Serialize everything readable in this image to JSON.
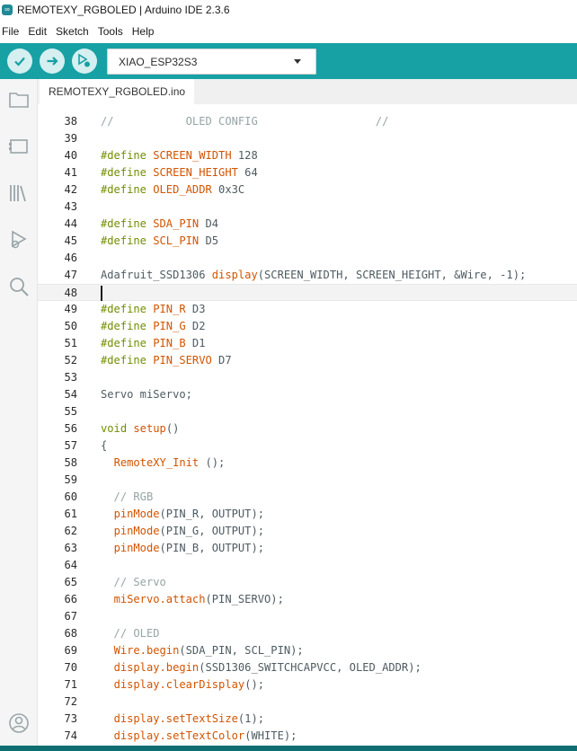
{
  "window": {
    "title": "REMOTEXY_RGBOLED | Arduino IDE 2.3.6",
    "app_icon": "arduino-icon"
  },
  "menu": [
    "File",
    "Edit",
    "Sketch",
    "Tools",
    "Help"
  ],
  "toolbar": {
    "verify": "check-icon",
    "upload": "arrow-right-icon",
    "debug": "debug-icon",
    "board": "XIAO_ESP32S3",
    "accent": "#17a1a5"
  },
  "sidebar": [
    "folder-icon",
    "board-icon",
    "library-icon",
    "debug-icon",
    "search-icon",
    "account-icon"
  ],
  "tab": {
    "label": "REMOTEXY_RGBOLED.ino"
  },
  "editor": {
    "current_line": 48,
    "lines": [
      {
        "n": "38",
        "text": "//           OLED CONFIG                  //"
      },
      {
        "n": "39",
        "text": ""
      },
      {
        "n": "40",
        "text": "#define SCREEN_WIDTH 128"
      },
      {
        "n": "41",
        "text": "#define SCREEN_HEIGHT 64"
      },
      {
        "n": "42",
        "text": "#define OLED_ADDR 0x3C"
      },
      {
        "n": "43",
        "text": ""
      },
      {
        "n": "44",
        "text": "#define SDA_PIN D4"
      },
      {
        "n": "45",
        "text": "#define SCL_PIN D5"
      },
      {
        "n": "46",
        "text": ""
      },
      {
        "n": "47",
        "text": "Adafruit_SSD1306 display(SCREEN_WIDTH, SCREEN_HEIGHT, &Wire, -1);"
      },
      {
        "n": "48",
        "text": ""
      },
      {
        "n": "49",
        "text": "#define PIN_R D3"
      },
      {
        "n": "50",
        "text": "#define PIN_G D2"
      },
      {
        "n": "51",
        "text": "#define PIN_B D1"
      },
      {
        "n": "52",
        "text": "#define PIN_SERVO D7"
      },
      {
        "n": "53",
        "text": ""
      },
      {
        "n": "54",
        "text": "Servo miServo;"
      },
      {
        "n": "55",
        "text": ""
      },
      {
        "n": "56",
        "text": "void setup()"
      },
      {
        "n": "57",
        "text": "{"
      },
      {
        "n": "58",
        "text": "  RemoteXY_Init ();"
      },
      {
        "n": "59",
        "text": ""
      },
      {
        "n": "60",
        "text": "  // RGB"
      },
      {
        "n": "61",
        "text": "  pinMode(PIN_R, OUTPUT);"
      },
      {
        "n": "62",
        "text": "  pinMode(PIN_G, OUTPUT);"
      },
      {
        "n": "63",
        "text": "  pinMode(PIN_B, OUTPUT);"
      },
      {
        "n": "64",
        "text": ""
      },
      {
        "n": "65",
        "text": "  // Servo"
      },
      {
        "n": "66",
        "text": "  miServo.attach(PIN_SERVO);"
      },
      {
        "n": "67",
        "text": ""
      },
      {
        "n": "68",
        "text": "  // OLED"
      },
      {
        "n": "69",
        "text": "  Wire.begin(SDA_PIN, SCL_PIN);"
      },
      {
        "n": "70",
        "text": "  display.begin(SSD1306_SWITCHCAPVCC, OLED_ADDR);"
      },
      {
        "n": "71",
        "text": "  display.clearDisplay();"
      },
      {
        "n": "72",
        "text": ""
      },
      {
        "n": "73",
        "text": "  display.setTextSize(1);"
      },
      {
        "n": "74",
        "text": "  display.setTextColor(WHITE);"
      }
    ]
  }
}
